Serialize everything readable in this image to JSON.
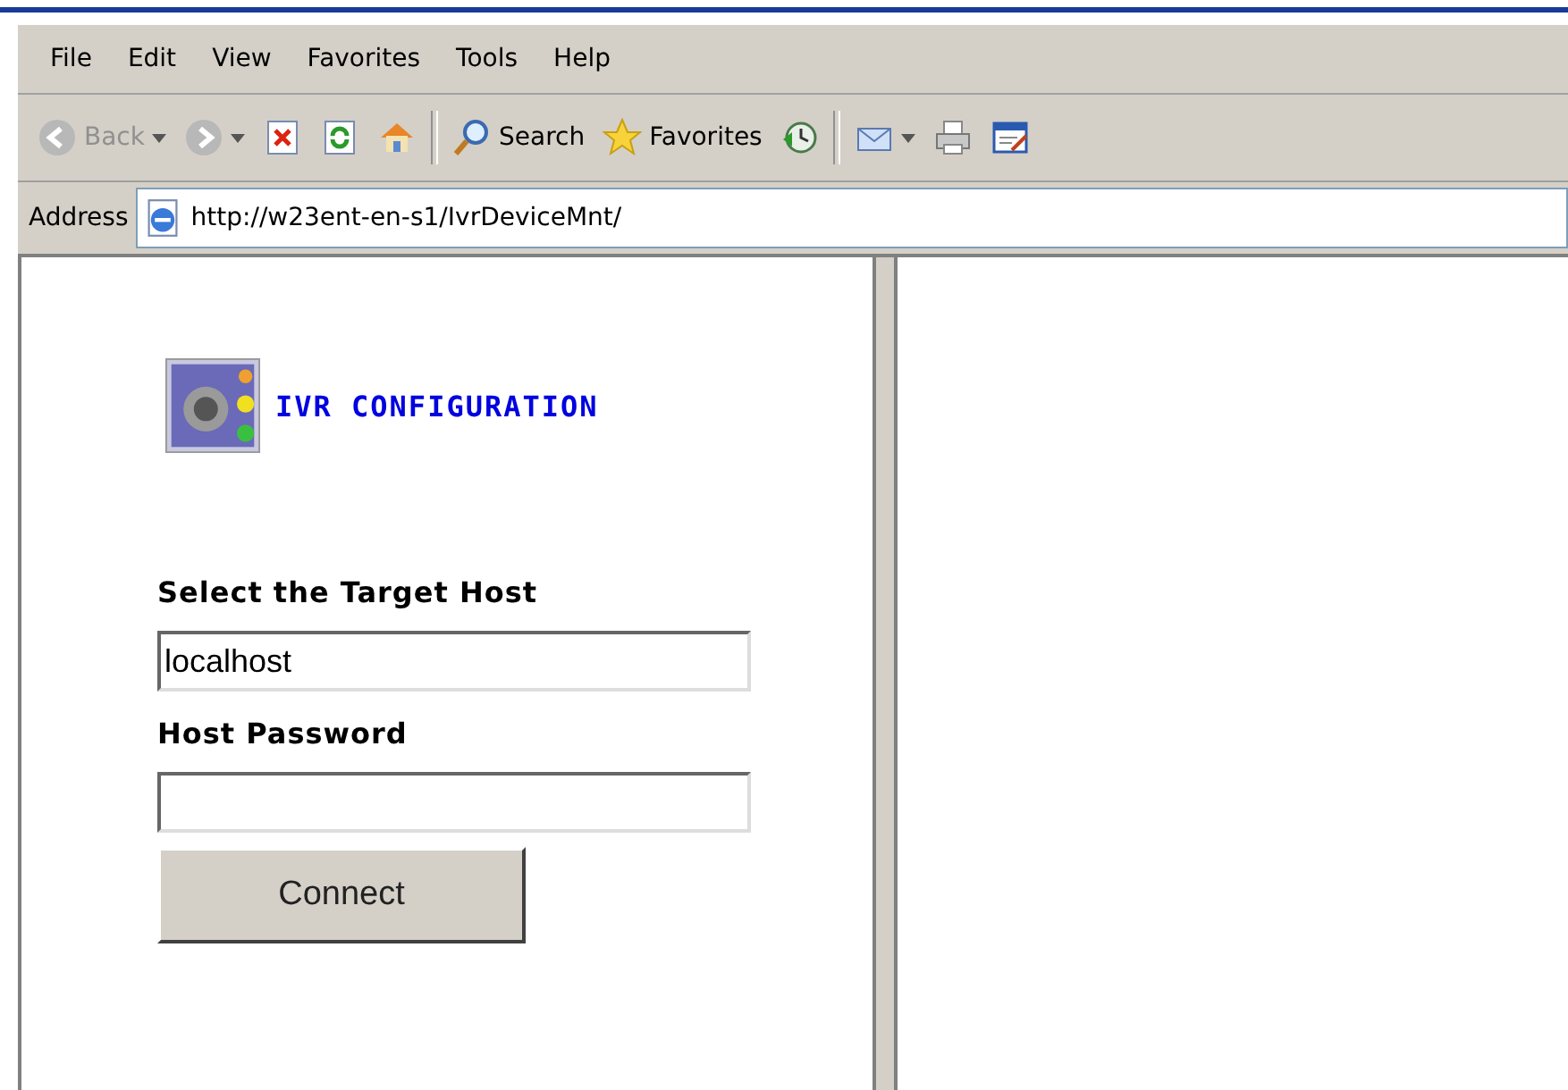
{
  "menu": [
    {
      "label": "File"
    },
    {
      "label": "Edit"
    },
    {
      "label": "View"
    },
    {
      "label": "Favorites"
    },
    {
      "label": "Tools"
    },
    {
      "label": "Help"
    }
  ],
  "toolbar": [
    {
      "kind": "back",
      "label": "Back",
      "disabled": true
    },
    {
      "kind": "forward",
      "disabled": true
    },
    {
      "kind": "stop"
    },
    {
      "kind": "refresh"
    },
    {
      "kind": "home"
    },
    {
      "kind": "sep"
    },
    {
      "kind": "search",
      "label": "Search"
    },
    {
      "kind": "favorites",
      "label": "Favorites"
    },
    {
      "kind": "history"
    },
    {
      "kind": "sep"
    },
    {
      "kind": "mail"
    },
    {
      "kind": "print"
    },
    {
      "kind": "edit"
    }
  ],
  "address": {
    "label": "Address",
    "value": "http://w23ent-en-s1/IvrDeviceMnt/"
  },
  "app": {
    "title": "IVR CONFIGURATION",
    "host_label": "Select the Target Host",
    "host_value": "localhost",
    "password_label": "Host Password",
    "connect": "Connect"
  }
}
